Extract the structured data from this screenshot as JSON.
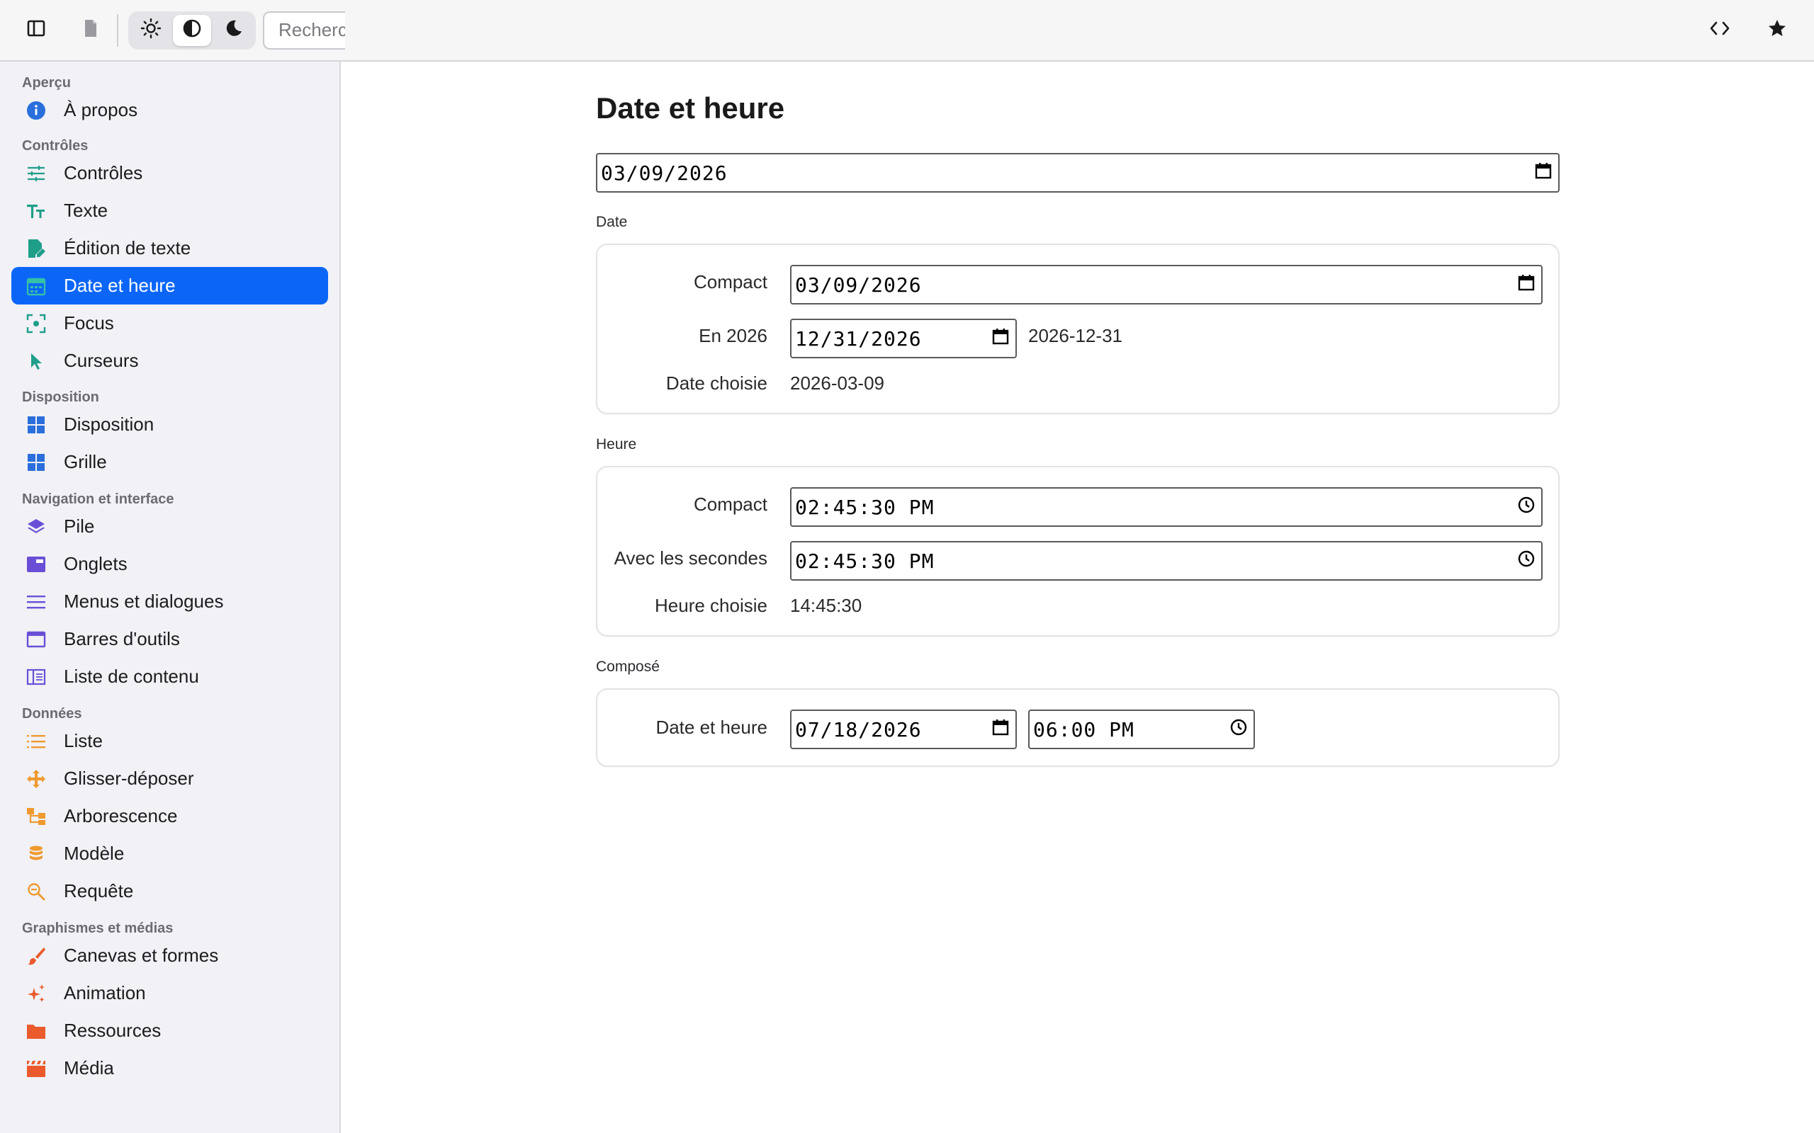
{
  "toolbar": {
    "search_placeholder": "Recherc"
  },
  "sidebar": {
    "sections": [
      {
        "title": "Aperçu",
        "items": [
          {
            "label": "À propos",
            "icon": "info-icon",
            "color": "#2a6fdb"
          }
        ]
      },
      {
        "title": "Contrôles",
        "items": [
          {
            "label": "Contrôles",
            "icon": "sliders-icon",
            "color": "#1f9e8a"
          },
          {
            "label": "Texte",
            "icon": "text-icon",
            "color": "#1f9e8a"
          },
          {
            "label": "Édition de texte",
            "icon": "edit-document-icon",
            "color": "#1f9e8a"
          },
          {
            "label": "Date et heure",
            "icon": "calendar-icon",
            "color": "#1f9e8a",
            "active": true
          },
          {
            "label": "Focus",
            "icon": "focus-icon",
            "color": "#1f9e8a"
          },
          {
            "label": "Curseurs",
            "icon": "cursor-icon",
            "color": "#1f9e8a"
          }
        ]
      },
      {
        "title": "Disposition",
        "items": [
          {
            "label": "Disposition",
            "icon": "dashboard-icon",
            "color": "#2a6fdb"
          },
          {
            "label": "Grille",
            "icon": "grid-icon",
            "color": "#2a6fdb"
          }
        ]
      },
      {
        "title": "Navigation et interface",
        "items": [
          {
            "label": "Pile",
            "icon": "layers-icon",
            "color": "#6a4fd6"
          },
          {
            "label": "Onglets",
            "icon": "tabs-icon",
            "color": "#6a4fd6"
          },
          {
            "label": "Menus et dialogues",
            "icon": "menu-icon",
            "color": "#6a4fd6"
          },
          {
            "label": "Barres d'outils",
            "icon": "window-icon",
            "color": "#6a4fd6"
          },
          {
            "label": "Liste de contenu",
            "icon": "columns-icon",
            "color": "#6a4fd6"
          }
        ]
      },
      {
        "title": "Données",
        "items": [
          {
            "label": "Liste",
            "icon": "list-icon",
            "color": "#ef9a2e"
          },
          {
            "label": "Glisser-déposer",
            "icon": "move-icon",
            "color": "#ef9a2e"
          },
          {
            "label": "Arborescence",
            "icon": "tree-icon",
            "color": "#ef9a2e"
          },
          {
            "label": "Modèle",
            "icon": "database-icon",
            "color": "#ef9a2e"
          },
          {
            "label": "Requête",
            "icon": "search-icon",
            "color": "#ef9a2e"
          }
        ]
      },
      {
        "title": "Graphismes et médias",
        "items": [
          {
            "label": "Canevas et formes",
            "icon": "brush-icon",
            "color": "#ea5a2c"
          },
          {
            "label": "Animation",
            "icon": "sparkle-icon",
            "color": "#ea5a2c"
          },
          {
            "label": "Ressources",
            "icon": "folder-icon",
            "color": "#ea5a2c"
          },
          {
            "label": "Média",
            "icon": "clapperboard-icon",
            "color": "#ea5a2c"
          }
        ]
      }
    ]
  },
  "main": {
    "title": "Date et heure",
    "top_date_value": "03/09/2026",
    "date_group": {
      "label": "Date",
      "compact_label": "Compact",
      "compact_value": "03/09/2026",
      "year_label": "En 2026",
      "year_value": "12/31/2026",
      "year_text": "2026-12-31",
      "chosen_label": "Date choisie",
      "chosen_value": "2026-03-09"
    },
    "time_group": {
      "label": "Heure",
      "compact_label": "Compact",
      "compact_value": "02:45:30 PM",
      "seconds_label": "Avec les secondes",
      "seconds_value": "02:45:30 PM",
      "chosen_label": "Heure choisie",
      "chosen_value": "14:45:30"
    },
    "composed_group": {
      "label": "Composé",
      "row_label": "Date et heure",
      "date_value": "07/18/2026",
      "time_value": "06:00 PM"
    }
  }
}
